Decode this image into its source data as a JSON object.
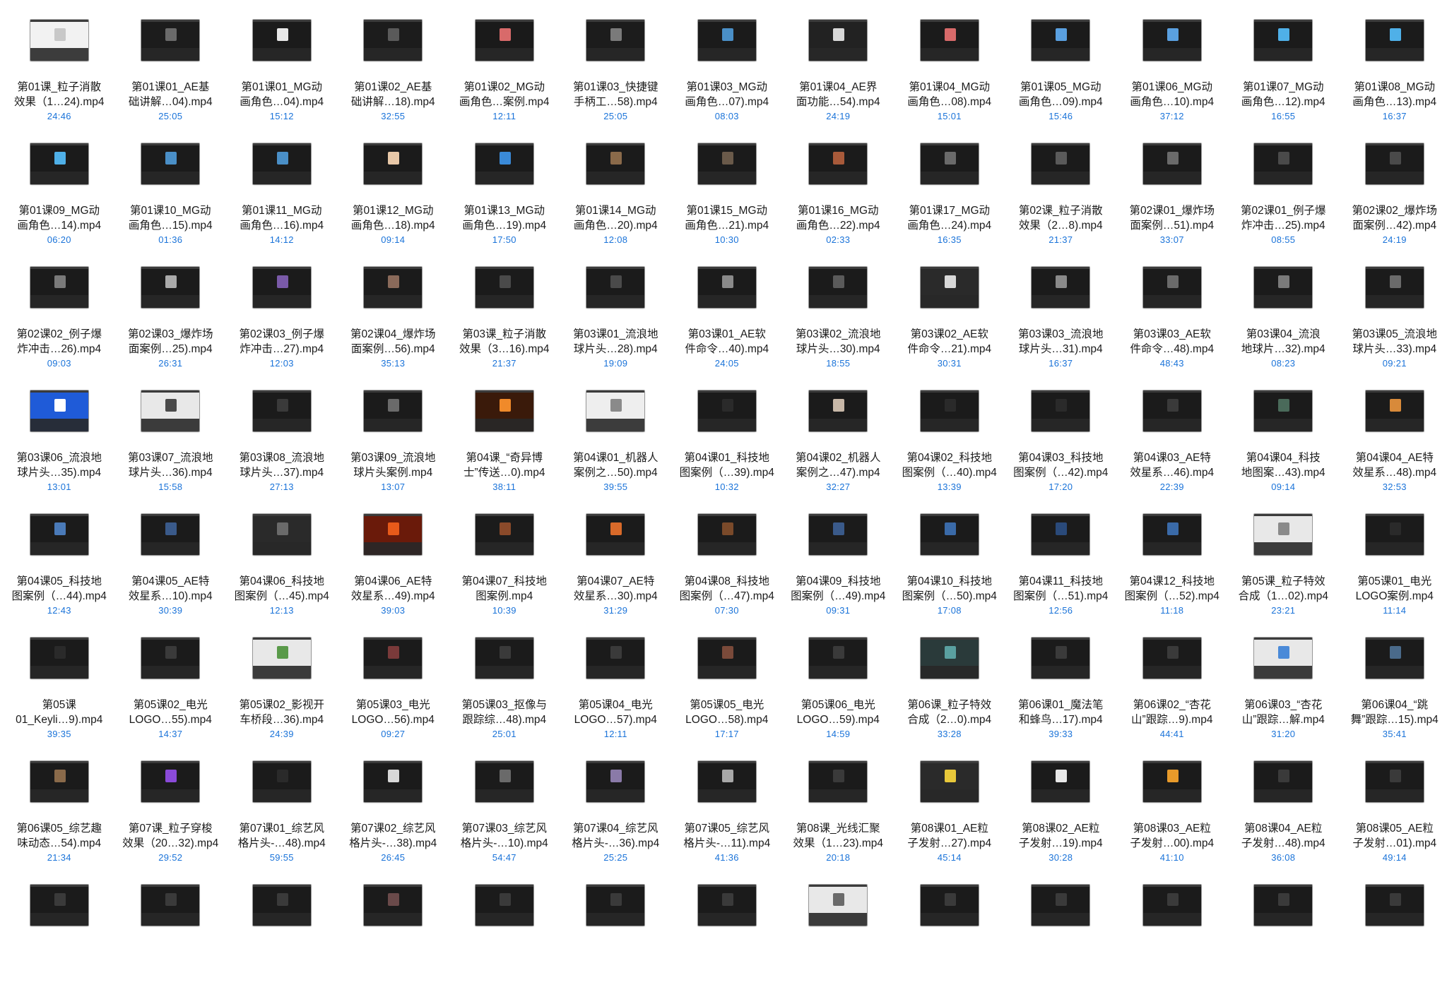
{
  "files": [
    {
      "name": "第01课_粒子消散\n效果（1…24).mp4",
      "duration": "24:46",
      "thumb": "#f2f2f2",
      "accent": "#c8c8c8"
    },
    {
      "name": "第01课01_AE基\n础讲解…04).mp4",
      "duration": "25:05",
      "thumb": "#1c1c1c",
      "accent": "#6a6a6a"
    },
    {
      "name": "第01课01_MG动\n画角色…04).mp4",
      "duration": "15:12",
      "thumb": "#1b1b1b",
      "accent": "#e8e8e8"
    },
    {
      "name": "第01课02_AE基\n础讲解…18).mp4",
      "duration": "32:55",
      "thumb": "#1c1c1c",
      "accent": "#5a5a5a"
    },
    {
      "name": "第01课02_MG动\n画角色…案例.mp4",
      "duration": "12:11",
      "thumb": "#1a1a1a",
      "accent": "#d86a6a"
    },
    {
      "name": "第01课03_快捷键\n手柄工…58).mp4",
      "duration": "25:05",
      "thumb": "#1c1c1c",
      "accent": "#7a7a7a"
    },
    {
      "name": "第01课03_MG动\n画角色…07).mp4",
      "duration": "08:03",
      "thumb": "#1b1b1b",
      "accent": "#4a8fc7"
    },
    {
      "name": "第01课04_AE界\n面功能…54).mp4",
      "duration": "24:19",
      "thumb": "#222222",
      "accent": "#d8d8d8"
    },
    {
      "name": "第01课04_MG动\n画角色…08).mp4",
      "duration": "15:01",
      "thumb": "#1b1b1b",
      "accent": "#d86a6a"
    },
    {
      "name": "第01课05_MG动\n画角色…09).mp4",
      "duration": "15:46",
      "thumb": "#1b1b1b",
      "accent": "#5aa0e0"
    },
    {
      "name": "第01课06_MG动\n画角色…10).mp4",
      "duration": "37:12",
      "thumb": "#1b1b1b",
      "accent": "#5aa0e0"
    },
    {
      "name": "第01课07_MG动\n画角色…12).mp4",
      "duration": "16:55",
      "thumb": "#1b1b1b",
      "accent": "#4fb0e8"
    },
    {
      "name": "第01课08_MG动\n画角色…13).mp4",
      "duration": "16:37",
      "thumb": "#1b1b1b",
      "accent": "#4fb0e8"
    },
    {
      "name": "第01课09_MG动\n画角色…14).mp4",
      "duration": "06:20",
      "thumb": "#1b1b1b",
      "accent": "#4fb0e8"
    },
    {
      "name": "第01课10_MG动\n画角色…15).mp4",
      "duration": "01:36",
      "thumb": "#1b1b1b",
      "accent": "#4a8fc7"
    },
    {
      "name": "第01课11_MG动\n画角色…16).mp4",
      "duration": "14:12",
      "thumb": "#1b1b1b",
      "accent": "#4a8fc7"
    },
    {
      "name": "第01课12_MG动\n画角色…18).mp4",
      "duration": "09:14",
      "thumb": "#1b1b1b",
      "accent": "#e8c8a8"
    },
    {
      "name": "第01课13_MG动\n画角色…19).mp4",
      "duration": "17:50",
      "thumb": "#1b1b1b",
      "accent": "#3a8ad8"
    },
    {
      "name": "第01课14_MG动\n画角色…20).mp4",
      "duration": "12:08",
      "thumb": "#1b1b1b",
      "accent": "#8a6a4a"
    },
    {
      "name": "第01课15_MG动\n画角色…21).mp4",
      "duration": "10:30",
      "thumb": "#1b1b1b",
      "accent": "#6a5a4a"
    },
    {
      "name": "第01课16_MG动\n画角色…22).mp4",
      "duration": "02:33",
      "thumb": "#1b1b1b",
      "accent": "#a85a3a"
    },
    {
      "name": "第01课17_MG动\n画角色…24).mp4",
      "duration": "16:35",
      "thumb": "#1b1b1b",
      "accent": "#6a6a6a"
    },
    {
      "name": "第02课_粒子消散\n效果（2…8).mp4",
      "duration": "21:37",
      "thumb": "#1b1b1b",
      "accent": "#5a5a5a"
    },
    {
      "name": "第02课01_爆炸场\n面案例…51).mp4",
      "duration": "33:07",
      "thumb": "#1b1b1b",
      "accent": "#6a6a6a"
    },
    {
      "name": "第02课01_例子爆\n炸冲击…25).mp4",
      "duration": "08:55",
      "thumb": "#1b1b1b",
      "accent": "#4a4a4a"
    },
    {
      "name": "第02课02_爆炸场\n面案例…42).mp4",
      "duration": "24:19",
      "thumb": "#1b1b1b",
      "accent": "#4a4a4a"
    },
    {
      "name": "第02课02_例子爆\n炸冲击…26).mp4",
      "duration": "09:03",
      "thumb": "#1b1b1b",
      "accent": "#7a7a7a"
    },
    {
      "name": "第02课03_爆炸场\n面案例…25).mp4",
      "duration": "26:31",
      "thumb": "#1b1b1b",
      "accent": "#aaaaaa"
    },
    {
      "name": "第02课03_例子爆\n炸冲击…27).mp4",
      "duration": "12:03",
      "thumb": "#1b1b1b",
      "accent": "#7a5aa8"
    },
    {
      "name": "第02课04_爆炸场\n面案例…56).mp4",
      "duration": "35:13",
      "thumb": "#1b1b1b",
      "accent": "#8a6a5a"
    },
    {
      "name": "第03课_粒子消散\n效果（3…16).mp4",
      "duration": "21:37",
      "thumb": "#1b1b1b",
      "accent": "#4a4a4a"
    },
    {
      "name": "第03课01_流浪地\n球片头…28).mp4",
      "duration": "19:09",
      "thumb": "#1b1b1b",
      "accent": "#4a4a4a"
    },
    {
      "name": "第03课01_AE软\n件命令…40).mp4",
      "duration": "24:05",
      "thumb": "#1b1b1b",
      "accent": "#8a8a8a"
    },
    {
      "name": "第03课02_流浪地\n球片头…30).mp4",
      "duration": "18:55",
      "thumb": "#1b1b1b",
      "accent": "#5a5a5a"
    },
    {
      "name": "第03课02_AE软\n件命令…21).mp4",
      "duration": "30:31",
      "thumb": "#2a2a2a",
      "accent": "#d8d8d8"
    },
    {
      "name": "第03课03_流浪地\n球片头…31).mp4",
      "duration": "16:37",
      "thumb": "#1b1b1b",
      "accent": "#8a8a8a"
    },
    {
      "name": "第03课03_AE软\n件命令…48).mp4",
      "duration": "48:43",
      "thumb": "#1b1b1b",
      "accent": "#6a6a6a"
    },
    {
      "name": "第03课04_流浪\n地球片…32).mp4",
      "duration": "08:23",
      "thumb": "#1b1b1b",
      "accent": "#7a7a7a"
    },
    {
      "name": "第03课05_流浪地\n球片头…33).mp4",
      "duration": "09:21",
      "thumb": "#1b1b1b",
      "accent": "#6a6a6a"
    },
    {
      "name": "第03课06_流浪地\n球片头…35).mp4",
      "duration": "13:01",
      "thumb": "#1f5bd8",
      "accent": "#ffffff"
    },
    {
      "name": "第03课07_流浪地\n球片头…36).mp4",
      "duration": "15:58",
      "thumb": "#e8e8e8",
      "accent": "#4a4a4a"
    },
    {
      "name": "第03课08_流浪地\n球片头…37).mp4",
      "duration": "27:13",
      "thumb": "#1b1b1b",
      "accent": "#3a3a3a"
    },
    {
      "name": "第03课09_流浪地\n球片头案例.mp4",
      "duration": "13:07",
      "thumb": "#1b1b1b",
      "accent": "#6a6a6a"
    },
    {
      "name": "第04课_“奇异博\n士”传送…0).mp4",
      "duration": "38:11",
      "thumb": "#3a1a0a",
      "accent": "#f08a2a"
    },
    {
      "name": "第04课01_机器人\n案例之…50).mp4",
      "duration": "39:55",
      "thumb": "#eeeeee",
      "accent": "#8a8a8a"
    },
    {
      "name": "第04课01_科技地\n图案例（…39).mp4",
      "duration": "10:32",
      "thumb": "#1b1b1b",
      "accent": "#2a2a2a"
    },
    {
      "name": "第04课02_机器人\n案例之…47).mp4",
      "duration": "32:27",
      "thumb": "#1b1b1b",
      "accent": "#c8b8a8"
    },
    {
      "name": "第04课02_科技地\n图案例（…40).mp4",
      "duration": "13:39",
      "thumb": "#1b1b1b",
      "accent": "#2a2a2a"
    },
    {
      "name": "第04课03_科技地\n图案例（…42).mp4",
      "duration": "17:20",
      "thumb": "#1b1b1b",
      "accent": "#2a2a2a"
    },
    {
      "name": "第04课03_AE特\n效星系…46).mp4",
      "duration": "22:39",
      "thumb": "#1b1b1b",
      "accent": "#3a3a3a"
    },
    {
      "name": "第04课04_科技\n地图案…43).mp4",
      "duration": "09:14",
      "thumb": "#1b1b1b",
      "accent": "#4a6a5a"
    },
    {
      "name": "第04课04_AE特\n效星系…48).mp4",
      "duration": "32:53",
      "thumb": "#1b1b1b",
      "accent": "#d88a3a"
    },
    {
      "name": "第04课05_科技地\n图案例（…44).mp4",
      "duration": "12:43",
      "thumb": "#1b1b1b",
      "accent": "#4a7ab8"
    },
    {
      "name": "第04课05_AE特\n效星系…10).mp4",
      "duration": "30:39",
      "thumb": "#1b1b1b",
      "accent": "#3a5a8a"
    },
    {
      "name": "第04课06_科技地\n图案例（…45).mp4",
      "duration": "12:13",
      "thumb": "#2a2a2a",
      "accent": "#6a6a6a"
    },
    {
      "name": "第04课06_AE特\n效星系…49).mp4",
      "duration": "39:03",
      "thumb": "#6a1a0a",
      "accent": "#e85a1a"
    },
    {
      "name": "第04课07_科技地\n图案例.mp4",
      "duration": "10:39",
      "thumb": "#1b1b1b",
      "accent": "#8a4a2a"
    },
    {
      "name": "第04课07_AE特\n效星系…30).mp4",
      "duration": "31:29",
      "thumb": "#1b1b1b",
      "accent": "#d86a2a"
    },
    {
      "name": "第04课08_科技地\n图案例（…47).mp4",
      "duration": "07:30",
      "thumb": "#1b1b1b",
      "accent": "#7a4a2a"
    },
    {
      "name": "第04课09_科技地\n图案例（…49).mp4",
      "duration": "09:31",
      "thumb": "#1b1b1b",
      "accent": "#3a5a8a"
    },
    {
      "name": "第04课10_科技地\n图案例（…50).mp4",
      "duration": "17:08",
      "thumb": "#1b1b1b",
      "accent": "#3a6aa8"
    },
    {
      "name": "第04课11_科技地\n图案例（…51).mp4",
      "duration": "12:56",
      "thumb": "#1b1b1b",
      "accent": "#2a4a7a"
    },
    {
      "name": "第04课12_科技地\n图案例（…52).mp4",
      "duration": "11:18",
      "thumb": "#1b1b1b",
      "accent": "#3a6aa8"
    },
    {
      "name": "第05课_粒子特效\n合成（1…02).mp4",
      "duration": "23:21",
      "thumb": "#e8e8e8",
      "accent": "#8a8a8a"
    },
    {
      "name": "第05课01_电光\nLOGO案例.mp4",
      "duration": "11:14",
      "thumb": "#1b1b1b",
      "accent": "#2a2a2a"
    },
    {
      "name": "第05课\n01_Keyli…9).mp4",
      "duration": "39:35",
      "thumb": "#1b1b1b",
      "accent": "#2a2a2a"
    },
    {
      "name": "第05课02_电光\nLOGO…55).mp4",
      "duration": "14:37",
      "thumb": "#1b1b1b",
      "accent": "#3a3a3a"
    },
    {
      "name": "第05课02_影视开\n车桥段…36).mp4",
      "duration": "24:39",
      "thumb": "#e8e8e8",
      "accent": "#5a9a4a"
    },
    {
      "name": "第05课03_电光\nLOGO…56).mp4",
      "duration": "09:27",
      "thumb": "#1b1b1b",
      "accent": "#7a3a3a"
    },
    {
      "name": "第05课03_抠像与\n跟踪综…48).mp4",
      "duration": "25:01",
      "thumb": "#1b1b1b",
      "accent": "#3a3a3a"
    },
    {
      "name": "第05课04_电光\nLOGO…57).mp4",
      "duration": "12:11",
      "thumb": "#1b1b1b",
      "accent": "#3a3a3a"
    },
    {
      "name": "第05课05_电光\nLOGO…58).mp4",
      "duration": "17:17",
      "thumb": "#1b1b1b",
      "accent": "#7a4a3a"
    },
    {
      "name": "第05课06_电光\nLOGO…59).mp4",
      "duration": "14:59",
      "thumb": "#1b1b1b",
      "accent": "#3a3a3a"
    },
    {
      "name": "第06课_粒子特效\n合成（2…0).mp4",
      "duration": "33:28",
      "thumb": "#2a3a3a",
      "accent": "#5aa0a0"
    },
    {
      "name": "第06课01_魔法笔\n和蜂鸟…17).mp4",
      "duration": "39:33",
      "thumb": "#1b1b1b",
      "accent": "#3a3a3a"
    },
    {
      "name": "第06课02_“杏花\n山”跟踪…9).mp4",
      "duration": "44:41",
      "thumb": "#1b1b1b",
      "accent": "#3a3a3a"
    },
    {
      "name": "第06课03_“杏花\n山”跟踪…解.mp4",
      "duration": "31:20",
      "thumb": "#e8e8e8",
      "accent": "#4a8ad8"
    },
    {
      "name": "第06课04_“跳\n舞”跟踪…15).mp4",
      "duration": "35:41",
      "thumb": "#1b1b1b",
      "accent": "#4a6a8a"
    },
    {
      "name": "第06课05_综艺趣\n味动态…54).mp4",
      "duration": "21:34",
      "thumb": "#1b1b1b",
      "accent": "#8a6a4a"
    },
    {
      "name": "第07课_粒子穿梭\n效果（20…32).mp4",
      "duration": "29:52",
      "thumb": "#1b1b1b",
      "accent": "#8a4ad8"
    },
    {
      "name": "第07课01_综艺风\n格片头-…48).mp4",
      "duration": "59:55",
      "thumb": "#1b1b1b",
      "accent": "#2a2a2a"
    },
    {
      "name": "第07课02_综艺风\n格片头-…38).mp4",
      "duration": "26:45",
      "thumb": "#1b1b1b",
      "accent": "#d8d8d8"
    },
    {
      "name": "第07课03_综艺风\n格片头-…10).mp4",
      "duration": "54:47",
      "thumb": "#1b1b1b",
      "accent": "#6a6a6a"
    },
    {
      "name": "第07课04_综艺风\n格片头-…36).mp4",
      "duration": "25:25",
      "thumb": "#1b1b1b",
      "accent": "#8a7aa8"
    },
    {
      "name": "第07课05_综艺风\n格片头-…11).mp4",
      "duration": "41:36",
      "thumb": "#1b1b1b",
      "accent": "#a8a8a8"
    },
    {
      "name": "第08课_光线汇聚\n效果（1…23).mp4",
      "duration": "20:18",
      "thumb": "#1b1b1b",
      "accent": "#3a3a3a"
    },
    {
      "name": "第08课01_AE粒\n子发射…27).mp4",
      "duration": "45:14",
      "thumb": "#2a2a2a",
      "accent": "#e8c83a"
    },
    {
      "name": "第08课02_AE粒\n子发射…19).mp4",
      "duration": "30:28",
      "thumb": "#1b1b1b",
      "accent": "#e8e8e8"
    },
    {
      "name": "第08课03_AE粒\n子发射…00).mp4",
      "duration": "41:10",
      "thumb": "#1b1b1b",
      "accent": "#e89a2a"
    },
    {
      "name": "第08课04_AE粒\n子发射…48).mp4",
      "duration": "36:08",
      "thumb": "#1b1b1b",
      "accent": "#3a3a3a"
    },
    {
      "name": "第08课05_AE粒\n子发射…01).mp4",
      "duration": "49:14",
      "thumb": "#1b1b1b",
      "accent": "#3a3a3a"
    },
    {
      "name": "",
      "duration": "",
      "thumb": "#1b1b1b",
      "accent": "#3a3a3a"
    },
    {
      "name": "",
      "duration": "",
      "thumb": "#1b1b1b",
      "accent": "#3a3a3a"
    },
    {
      "name": "",
      "duration": "",
      "thumb": "#1b1b1b",
      "accent": "#3a3a3a"
    },
    {
      "name": "",
      "duration": "",
      "thumb": "#1b1b1b",
      "accent": "#6a4a4a"
    },
    {
      "name": "",
      "duration": "",
      "thumb": "#1b1b1b",
      "accent": "#3a3a3a"
    },
    {
      "name": "",
      "duration": "",
      "thumb": "#1b1b1b",
      "accent": "#3a3a3a"
    },
    {
      "name": "",
      "duration": "",
      "thumb": "#1b1b1b",
      "accent": "#3a3a3a"
    },
    {
      "name": "",
      "duration": "",
      "thumb": "#e8e8e8",
      "accent": "#6a6a6a"
    },
    {
      "name": "",
      "duration": "",
      "thumb": "#1b1b1b",
      "accent": "#3a3a3a"
    },
    {
      "name": "",
      "duration": "",
      "thumb": "#1b1b1b",
      "accent": "#3a3a3a"
    },
    {
      "name": "",
      "duration": "",
      "thumb": "#1b1b1b",
      "accent": "#3a3a3a"
    },
    {
      "name": "",
      "duration": "",
      "thumb": "#1b1b1b",
      "accent": "#3a3a3a"
    },
    {
      "name": "",
      "duration": "",
      "thumb": "#1b1b1b",
      "accent": "#3a3a3a"
    }
  ]
}
